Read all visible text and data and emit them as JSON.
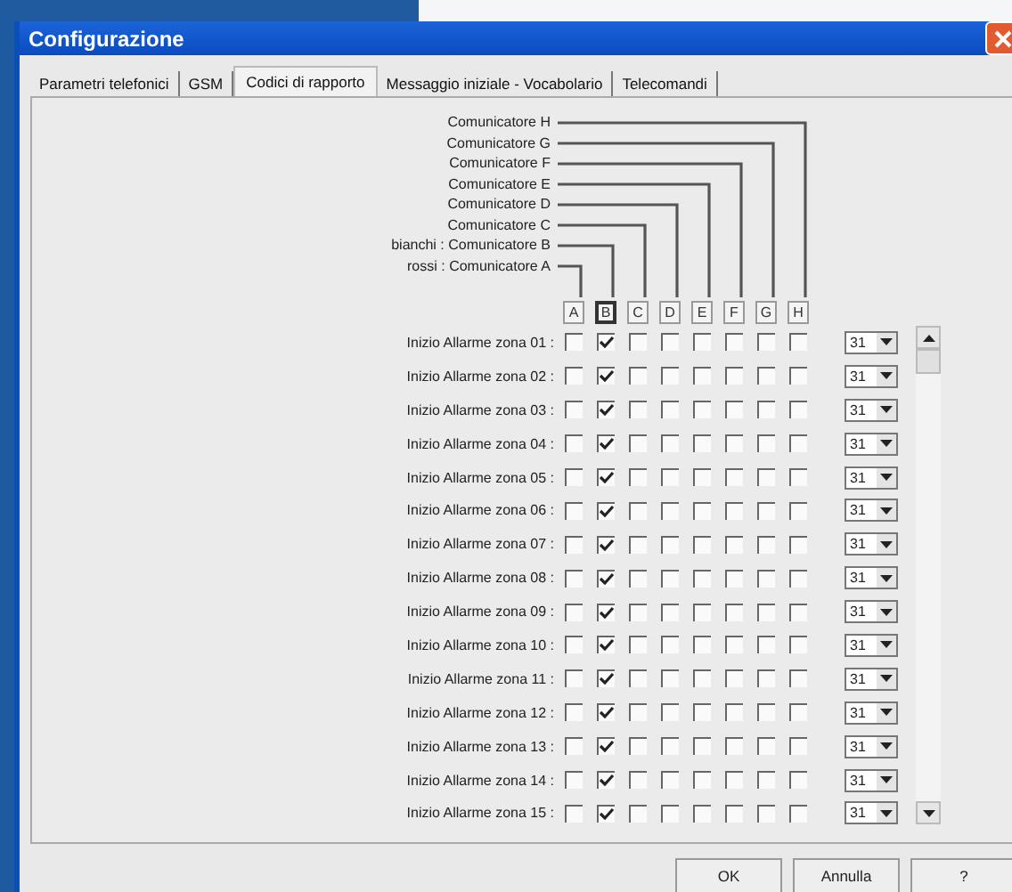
{
  "window": {
    "title": "Configurazione"
  },
  "tabs": [
    {
      "label": "Parametri telefonici",
      "selected": false
    },
    {
      "label": "GSM",
      "selected": false
    },
    {
      "label": "Codici di rapporto",
      "selected": true
    },
    {
      "label": "Messaggio iniziale - Vocabolario",
      "selected": false
    },
    {
      "label": "Telecomandi",
      "selected": false
    }
  ],
  "communicators": [
    "Comunicatore H",
    "Comunicatore G",
    "Comunicatore F",
    "Comunicatore E",
    "Comunicatore D",
    "Comunicatore C",
    "bianchi : Comunicatore B",
    "rossi : Comunicatore A"
  ],
  "columns": [
    {
      "label": "A",
      "selected": false
    },
    {
      "label": "B",
      "selected": true
    },
    {
      "label": "C",
      "selected": false
    },
    {
      "label": "D",
      "selected": false
    },
    {
      "label": "E",
      "selected": false
    },
    {
      "label": "F",
      "selected": false
    },
    {
      "label": "G",
      "selected": false
    },
    {
      "label": "H",
      "selected": false
    }
  ],
  "rows": [
    {
      "label": "Inizio Allarme zona 01 :",
      "checks": [
        false,
        true,
        false,
        false,
        false,
        false,
        false,
        false
      ],
      "value": "31"
    },
    {
      "label": "Inizio Allarme zona 02 :",
      "checks": [
        false,
        true,
        false,
        false,
        false,
        false,
        false,
        false
      ],
      "value": "31"
    },
    {
      "label": "Inizio Allarme zona 03 :",
      "checks": [
        false,
        true,
        false,
        false,
        false,
        false,
        false,
        false
      ],
      "value": "31"
    },
    {
      "label": "Inizio Allarme zona 04 :",
      "checks": [
        false,
        true,
        false,
        false,
        false,
        false,
        false,
        false
      ],
      "value": "31"
    },
    {
      "label": "Inizio Allarme zona 05 :",
      "checks": [
        false,
        true,
        false,
        false,
        false,
        false,
        false,
        false
      ],
      "value": "31"
    },
    {
      "label": "Inizio Allarme zona 06 :",
      "checks": [
        false,
        true,
        false,
        false,
        false,
        false,
        false,
        false
      ],
      "value": "31"
    },
    {
      "label": "Inizio Allarme zona 07 :",
      "checks": [
        false,
        true,
        false,
        false,
        false,
        false,
        false,
        false
      ],
      "value": "31"
    },
    {
      "label": "Inizio Allarme zona 08 :",
      "checks": [
        false,
        true,
        false,
        false,
        false,
        false,
        false,
        false
      ],
      "value": "31"
    },
    {
      "label": "Inizio Allarme zona 09 :",
      "checks": [
        false,
        true,
        false,
        false,
        false,
        false,
        false,
        false
      ],
      "value": "31"
    },
    {
      "label": "Inizio Allarme zona 10 :",
      "checks": [
        false,
        true,
        false,
        false,
        false,
        false,
        false,
        false
      ],
      "value": "31"
    },
    {
      "label": "Inizio Allarme zona 11 :",
      "checks": [
        false,
        true,
        false,
        false,
        false,
        false,
        false,
        false
      ],
      "value": "31"
    },
    {
      "label": "Inizio Allarme zona 12 :",
      "checks": [
        false,
        true,
        false,
        false,
        false,
        false,
        false,
        false
      ],
      "value": "31"
    },
    {
      "label": "Inizio Allarme zona 13 :",
      "checks": [
        false,
        true,
        false,
        false,
        false,
        false,
        false,
        false
      ],
      "value": "31"
    },
    {
      "label": "Inizio Allarme zona 14 :",
      "checks": [
        false,
        true,
        false,
        false,
        false,
        false,
        false,
        false
      ],
      "value": "31"
    },
    {
      "label": "Inizio Allarme zona 15 :",
      "checks": [
        false,
        true,
        false,
        false,
        false,
        false,
        false,
        false
      ],
      "value": "31"
    }
  ],
  "buttons": [
    "OK",
    "Annulla",
    "?"
  ]
}
